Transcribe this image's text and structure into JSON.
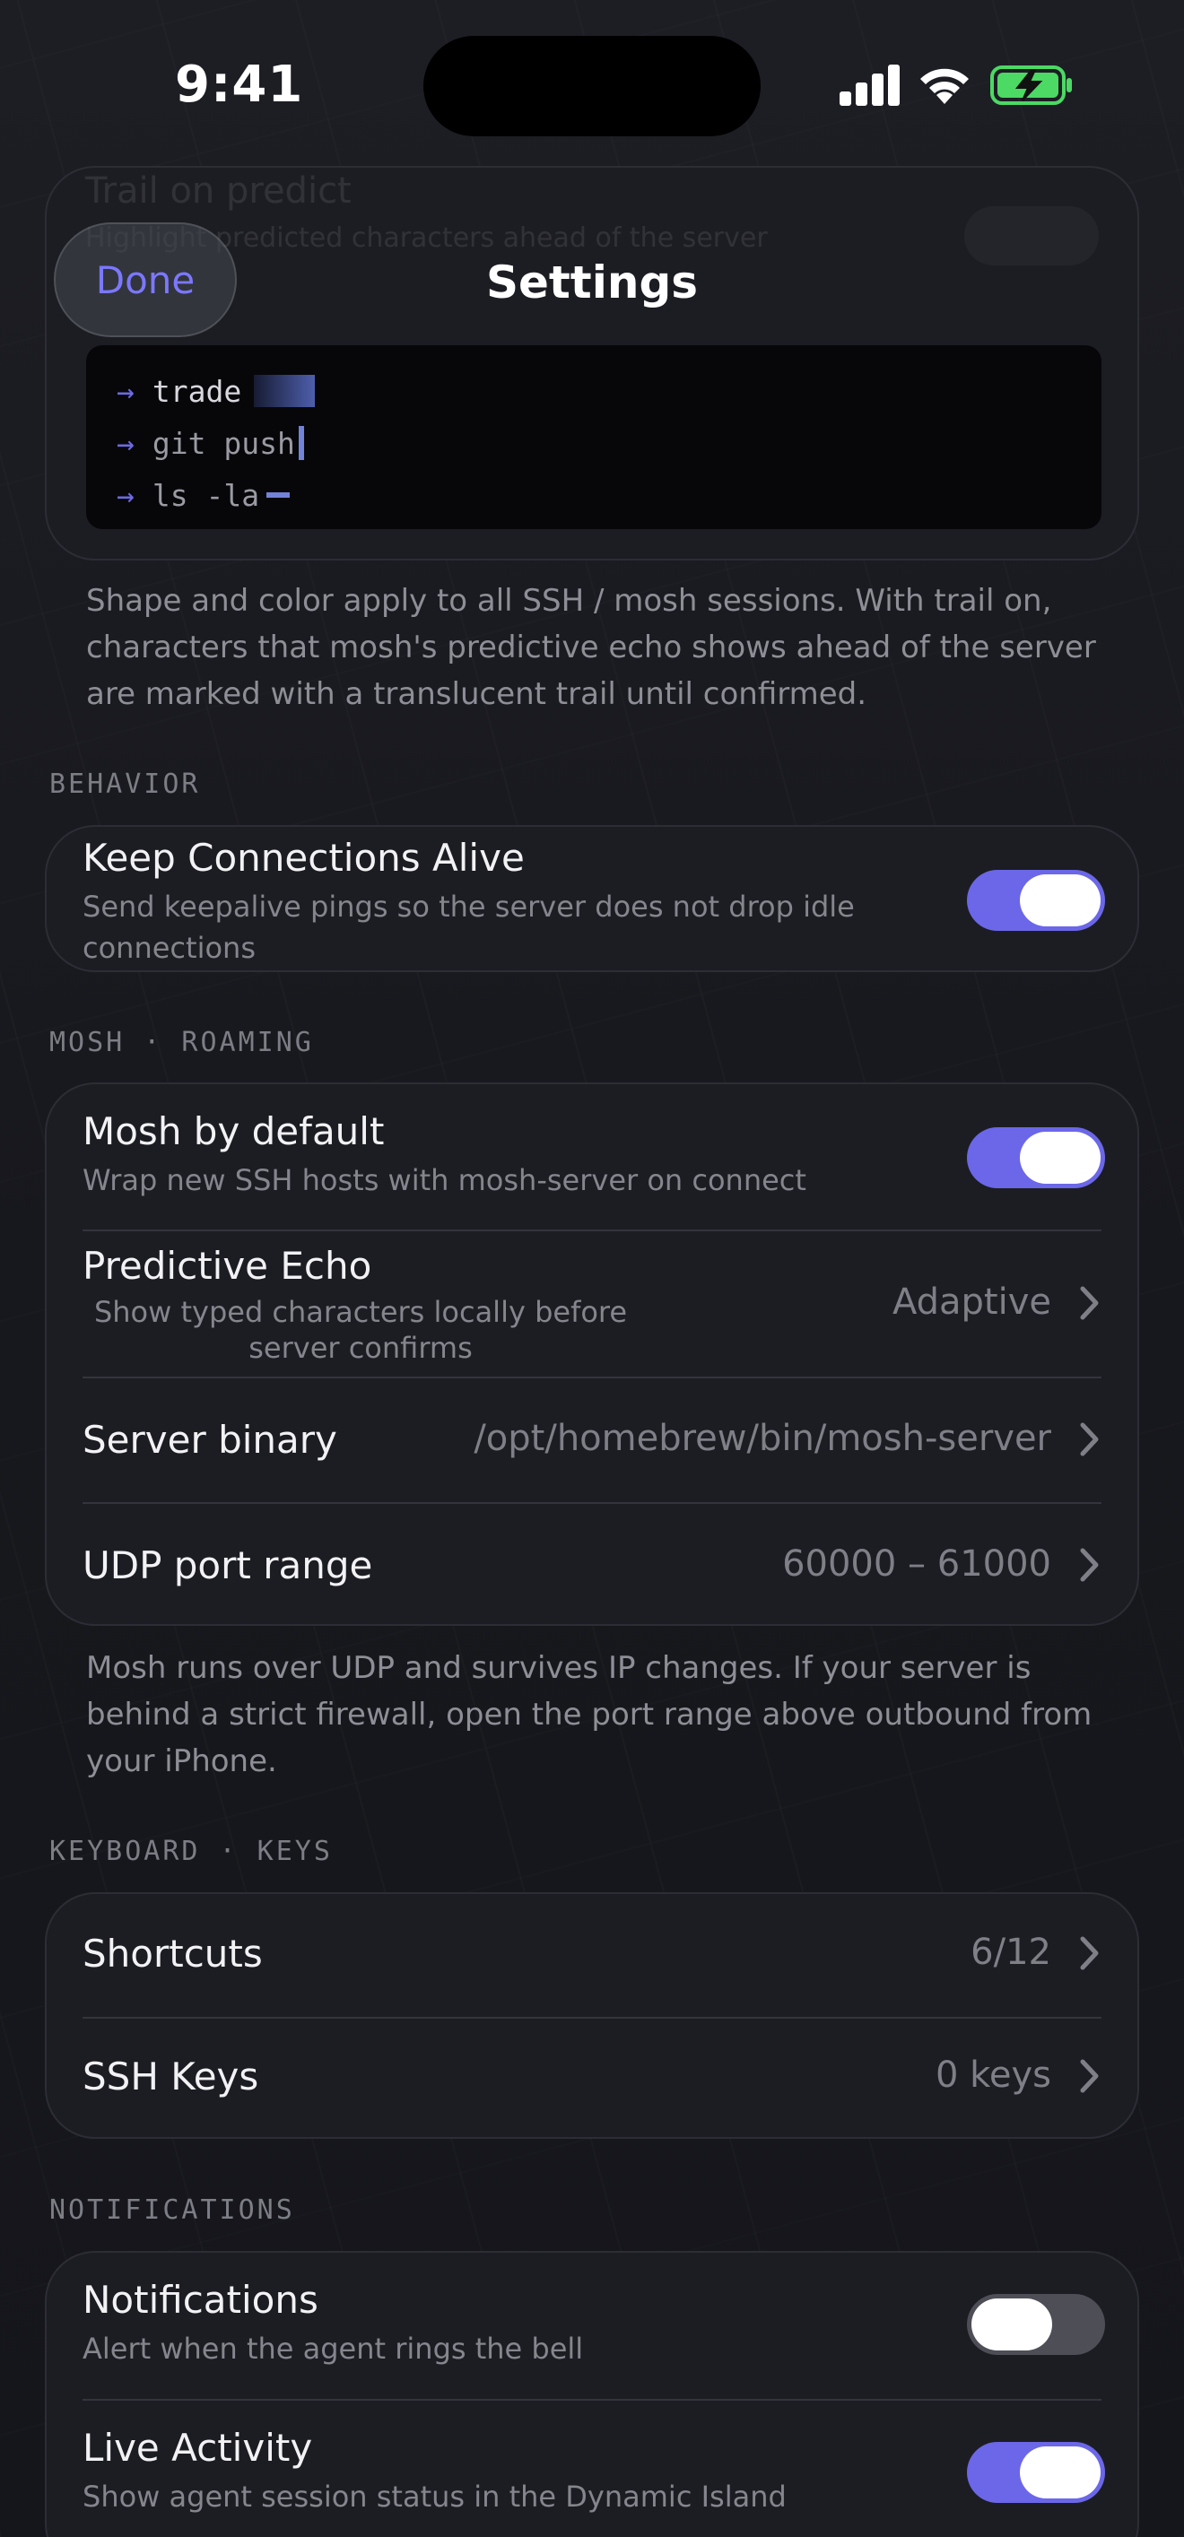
{
  "status_bar": {
    "time": "9:41"
  },
  "header": {
    "done_label": "Done",
    "title": "Settings"
  },
  "ghost": {
    "title": "Trail on predict",
    "subtitle": "Highlight predicted characters ahead of the server"
  },
  "cursor_preview": {
    "lines": [
      {
        "prompt": "→",
        "command": "trade",
        "cursor": "block"
      },
      {
        "prompt": "→",
        "command": "git push",
        "cursor": "bar"
      },
      {
        "prompt": "→",
        "command": "ls -la",
        "cursor": "underline"
      }
    ],
    "footnote": "Shape and color apply to all SSH / mosh sessions. With trail on, characters that mosh's predictive echo shows ahead of the server are marked with a translucent trail until confirmed."
  },
  "behavior": {
    "label": "BEHAVIOR",
    "keep_alive": {
      "title": "Keep Connections Alive",
      "subtitle": "Send keepalive pings so the server does not drop idle connections",
      "enabled": true
    }
  },
  "mosh": {
    "label": "MOSH · ROAMING",
    "by_default": {
      "title": "Mosh by default",
      "subtitle": "Wrap new SSH hosts with mosh-server on connect",
      "enabled": true
    },
    "predictive_echo": {
      "title": "Predictive Echo",
      "subtitle": "Show typed characters locally before server confirms",
      "value": "Adaptive"
    },
    "server_binary": {
      "title": "Server binary",
      "value": "/opt/homebrew/bin/mosh-server"
    },
    "udp_range": {
      "title": "UDP port range",
      "value": "60000 – 61000"
    },
    "footnote": "Mosh runs over UDP and survives IP changes. If your server is behind a strict firewall, open the port range above outbound from your iPhone."
  },
  "keyboard": {
    "label": "KEYBOARD · KEYS",
    "shortcuts": {
      "title": "Shortcuts",
      "value": "6/12"
    },
    "ssh_keys": {
      "title": "SSH Keys",
      "value": "0 keys"
    }
  },
  "notifications": {
    "label": "NOTIFICATIONS",
    "notifications": {
      "title": "Notifications",
      "subtitle": "Alert when the agent rings the bell",
      "enabled": false
    },
    "live_activity": {
      "title": "Live Activity",
      "subtitle": "Show agent session status in the Dynamic Island",
      "enabled": true
    }
  },
  "colors": {
    "accent": "#6b67e8",
    "done_text": "#7b78ff",
    "background": "#16171c",
    "card": "#1c1d23"
  }
}
